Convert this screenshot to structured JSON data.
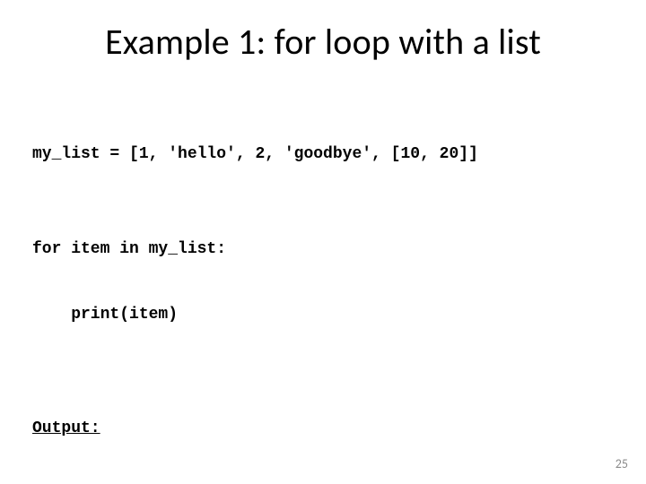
{
  "title": "Example 1: for loop with a list",
  "code": {
    "line1": "my_list = [1, 'hello', 2, 'goodbye', [10, 20]]",
    "line2": "for item in my_list:",
    "line3": "    print(item)"
  },
  "output_label": "Output:",
  "page_number": "25"
}
